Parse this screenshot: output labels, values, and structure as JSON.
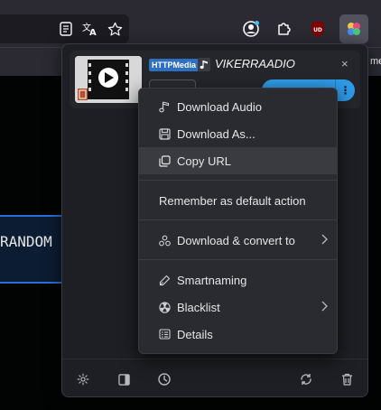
{
  "browser": {
    "bookmarks_bar_edge_text": "me",
    "page_text": "RANDOM",
    "extension_badge_text": "UD"
  },
  "popup": {
    "media": {
      "badge": "HTTPMedia",
      "title": "VIKERRAADIO",
      "close_label": "×",
      "more_label": "⋮"
    },
    "menu": {
      "items": [
        {
          "label": "Download Audio",
          "icon": "music-note-icon"
        },
        {
          "label": "Download As...",
          "icon": "save-icon"
        },
        {
          "label": "Copy URL",
          "icon": "copy-icon"
        },
        {
          "label": "Remember as default action"
        },
        {
          "label": "Download & convert to",
          "icon": "convert-icon",
          "submenu": true
        },
        {
          "label": "Smartnaming",
          "icon": "pen-icon"
        },
        {
          "label": "Blacklist",
          "icon": "radiation-icon",
          "submenu": true
        },
        {
          "label": "Details",
          "icon": "details-icon"
        }
      ]
    },
    "footer": {
      "buttons": [
        "gear-icon",
        "sidebar-icon",
        "clock-icon",
        "refresh-icon",
        "trash-icon"
      ]
    }
  },
  "colors": {
    "accent": "#2f9be8",
    "badge": "#2e6fc0",
    "menu_bg": "#2a2b30",
    "popup_bg": "#1e1f24"
  }
}
